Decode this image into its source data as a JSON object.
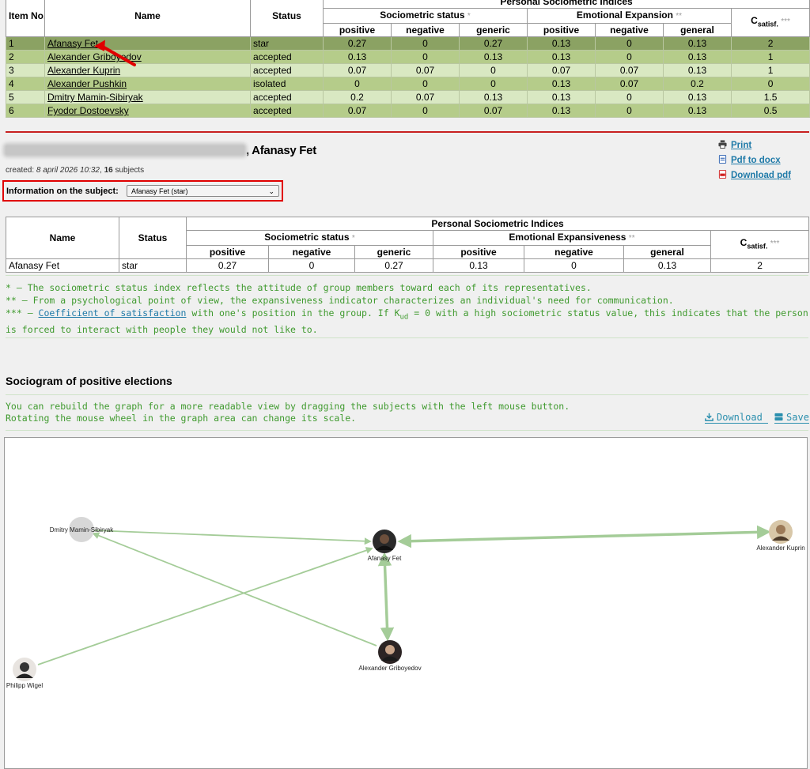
{
  "top_table": {
    "headers": {
      "item_no": "Item No.",
      "name": "Name",
      "status": "Status",
      "group": "Personal Sociometric Indices",
      "socio": "Sociometric status",
      "socio_ast": "*",
      "emo": "Emotional Expansion",
      "emo_ast": "**",
      "csat_main": "C",
      "csat_sub": "satisf.",
      "csat_ast": "***",
      "cols": [
        "positive",
        "negative",
        "generic",
        "positive",
        "negative",
        "general"
      ]
    },
    "rows": [
      {
        "no": "1",
        "name": "Afanasy Fet",
        "status": "star",
        "v": [
          "0.27",
          "0",
          "0.27",
          "0.13",
          "0",
          "0.13"
        ],
        "c": "2"
      },
      {
        "no": "2",
        "name": "Alexander Griboyedov",
        "status": "accepted",
        "v": [
          "0.13",
          "0",
          "0.13",
          "0.13",
          "0",
          "0.13"
        ],
        "c": "1"
      },
      {
        "no": "3",
        "name": "Alexander Kuprin",
        "status": "accepted",
        "v": [
          "0.07",
          "0.07",
          "0",
          "0.07",
          "0.07",
          "0.13"
        ],
        "c": "1"
      },
      {
        "no": "4",
        "name": "Alexander Pushkin",
        "status": "isolated",
        "v": [
          "0",
          "0",
          "0",
          "0.13",
          "0.07",
          "0.2"
        ],
        "c": "0"
      },
      {
        "no": "5",
        "name": "Dmitry Mamin-Sibiryak",
        "status": "accepted",
        "v": [
          "0.2",
          "0.07",
          "0.13",
          "0.13",
          "0",
          "0.13"
        ],
        "c": "1.5"
      },
      {
        "no": "6",
        "name": "Fyodor Dostoevsky",
        "status": "accepted",
        "v": [
          "0.07",
          "0",
          "0.07",
          "0.13",
          "0",
          "0.13"
        ],
        "c": "0.5"
      }
    ]
  },
  "doc": {
    "title_suffix": ", Afanasy Fet",
    "created_label": "created:",
    "created_date": "8 april 2026 10:32",
    "subjects_count": "16",
    "subjects_label": "subjects"
  },
  "links": {
    "print": "Print",
    "pdf_docx": "Pdf to docx",
    "download_pdf": "Download pdf"
  },
  "subject_select": {
    "label": "Information on the subject:",
    "value": "Afanasy Fet (star)"
  },
  "subject_table": {
    "name": "Name",
    "status": "Status",
    "group": "Personal Sociometric Indices",
    "socio": "Sociometric status",
    "socio_ast": "*",
    "emo": "Emotional Expansiveness",
    "emo_ast": "**",
    "csat_main": "C",
    "csat_sub": "satisf.",
    "csat_ast": "***",
    "cols": [
      "positive",
      "negative",
      "generic",
      "positive",
      "negative",
      "general"
    ],
    "row": {
      "name": "Afanasy Fet",
      "status": "star",
      "v": [
        "0.27",
        "0",
        "0.27",
        "0.13",
        "0",
        "0.13"
      ],
      "c": "2"
    }
  },
  "notes": {
    "n1": "* – The sociometric status index reflects the attitude of group members toward each of its representatives.",
    "n2": "** – From a psychological point of view, the expansiveness indicator characterizes an individual's need for communication.",
    "n3_prefix": "*** – ",
    "n3_link": "Coefficient of satisfaction",
    "n3_mid": " with one's position in the group. If K",
    "n3_sub": "ud",
    "n3_rest": " = 0 with a high sociometric status value, this indicates that the person is forced to interact with people they would not like to."
  },
  "sociogram": {
    "title": "Sociogram of positive elections",
    "hint1": "You can rebuild the graph for a more readable view by dragging the subjects with the left mouse button.",
    "hint2": "Rotating the mouse wheel in the graph area can change its scale.",
    "download": "Download",
    "save": "Save",
    "nodes": [
      "Dmitry Mamin-Sibiryak",
      "Afanasy Fet",
      "Alexander Kuprin",
      "Alexander Griboyedov",
      "Philipp Wigel"
    ]
  },
  "colors": {
    "selected_row": "#8ba263",
    "row_dark": "#b5cc8a",
    "row_light": "#d9e8c2",
    "accent_red": "#e00000",
    "note_green": "#3f9a2e",
    "link_blue": "#1f7aa8",
    "edge_green": "#a4cc98"
  }
}
